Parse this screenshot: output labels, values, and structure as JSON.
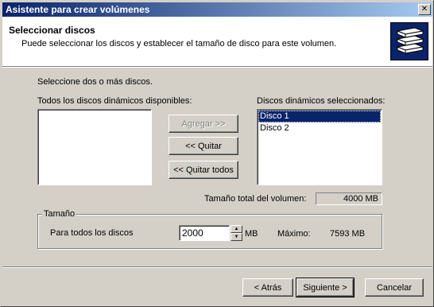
{
  "window": {
    "title": "Asistente para crear volúmenes",
    "close_glyph": "✕"
  },
  "header": {
    "title": "Seleccionar discos",
    "subtitle": "Puede seleccionar los discos y establecer el tamaño de disco para este volumen.",
    "icon": "disks-icon"
  },
  "body": {
    "instruction": "Seleccione dos o más discos.",
    "available_label": "Todos los discos dinámicos disponibles:",
    "available_items": [],
    "selected_label": "Discos dinámicos seleccionados:",
    "selected_items": [
      "Disco 1",
      "Disco 2"
    ],
    "selected_index": 0,
    "buttons": {
      "add": "Agregar >>",
      "remove": "<< Quitar",
      "remove_all": "<< Quitar todos"
    },
    "total_label": "Tamaño total del volumen:",
    "total_value": "4000 MB"
  },
  "size": {
    "legend": "Tamaño",
    "per_disk_label": "Para todos los discos",
    "value": "2000",
    "unit": "MB",
    "max_label": "Máximo:",
    "max_value": "7593 MB"
  },
  "footer": {
    "back": "< Atrás",
    "next": "Siguiente >",
    "cancel": "Cancelar"
  },
  "colors": {
    "titlebar_start": "#0a246a",
    "titlebar_end": "#a6caf0",
    "selection": "#0a246a",
    "face": "#d4d0c8"
  }
}
